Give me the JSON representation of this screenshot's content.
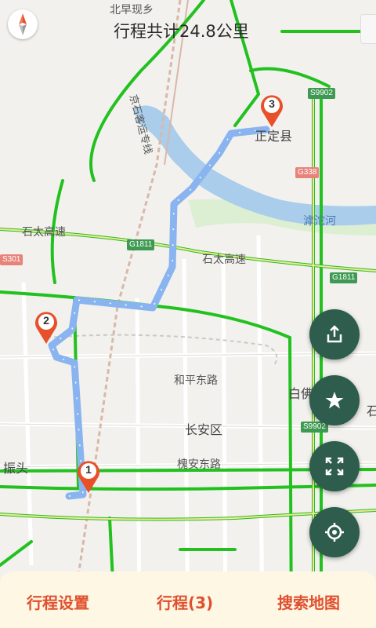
{
  "header": {
    "trip_total": "行程共计24.8公里"
  },
  "map_labels": {
    "village_top": "北早现乡",
    "railway": "京石客运专线",
    "zhengding": "正定县",
    "hutuo_river": "滹沱河",
    "shitai_left": "石太高速",
    "shitai_right": "石太高速",
    "heping": "和平东路",
    "changan": "长安区",
    "huaian": "槐安东路",
    "zhentou": "振头",
    "baifo": "白佛",
    "shi_edge": "石"
  },
  "road_shields": {
    "s9902_top": "S9902",
    "g338": "G338",
    "g1811_left": "G1811",
    "s301": "S301",
    "g1811_right": "G1811",
    "s9902_bottom": "S9902"
  },
  "waypoints": [
    "1",
    "2",
    "3"
  ],
  "actions": {
    "share_icon": "share-icon",
    "favorite_icon": "star-icon",
    "fullscreen_icon": "fullscreen-icon",
    "locate_icon": "locate-icon"
  },
  "bottom_tabs": {
    "settings": "行程设置",
    "trip": "行程(3)",
    "search": "搜索地图"
  },
  "colors": {
    "route": "#8ab4f0",
    "traffic_green": "#22c11f",
    "fab": "#2e5d4d",
    "accent": "#e0502e",
    "pin": "#e8502a"
  }
}
